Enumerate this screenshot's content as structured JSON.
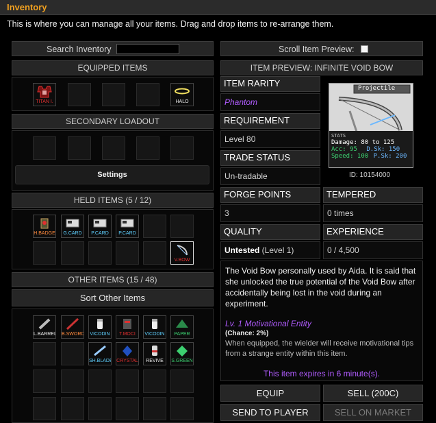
{
  "window": {
    "title": "Inventory"
  },
  "description": "This is where you can manage all your items. Drag and drop items to re-arrange them.",
  "search": {
    "label": "Search Inventory",
    "value": "",
    "placeholder": ""
  },
  "scroll_preview": {
    "label": "Scroll Item Preview:",
    "checked": false
  },
  "sections": {
    "equipped": "EQUIPPED ITEMS",
    "secondary": "SECONDARY LOADOUT",
    "settings_button": "Settings",
    "held": "HELD ITEMS (5 / 12)",
    "other": "OTHER ITEMS (15 / 48)",
    "sort_button": "Sort Other Items"
  },
  "equipped_items": [
    {
      "label": "TITAN I.",
      "icon": "titan-icon",
      "color": "#e03030"
    },
    {
      "label": "HALO",
      "icon": "halo-icon",
      "color": "#f0f0f0"
    }
  ],
  "held_items": [
    {
      "label": "H.BADGE",
      "icon": "badge-icon",
      "color": "#ff8a3d"
    },
    {
      "label": "G.CARD",
      "icon": "card-icon",
      "color": "#5fd0ff"
    },
    {
      "label": "P.CARD",
      "icon": "card-icon",
      "color": "#5fd0ff"
    },
    {
      "label": "P.CARD",
      "icon": "card-icon",
      "color": "#5fd0ff"
    },
    {
      "label": "V.BOW",
      "icon": "bow-icon",
      "color": "#e03030"
    }
  ],
  "other_items": [
    {
      "label": "L.BARREL",
      "icon": "barrel-icon",
      "color": "#f0f0f0"
    },
    {
      "label": "B.SWORD",
      "icon": "sword-icon",
      "color": "#ff8a3d"
    },
    {
      "label": "VICODIN",
      "icon": "pill-icon",
      "color": "#5fd0ff"
    },
    {
      "label": "T.MOCI",
      "icon": "potion-icon",
      "color": "#e03030"
    },
    {
      "label": "VICODIN",
      "icon": "pill-icon",
      "color": "#5fd0ff"
    },
    {
      "label": "PAPER",
      "icon": "hat-icon",
      "color": "#3cd070"
    },
    {
      "label": "SH.BLADE",
      "icon": "blade-icon",
      "color": "#5fd0ff"
    },
    {
      "label": "CRYSTAL",
      "icon": "crystal-icon",
      "color": "#e03030"
    },
    {
      "label": "REVIVE",
      "icon": "revive-icon",
      "color": "#f0f0f0"
    },
    {
      "label": "S.GREEN",
      "icon": "gem-icon",
      "color": "#3cd070"
    }
  ],
  "preview": {
    "header": "ITEM PREVIEW: INFINITE VOID BOW",
    "card_title": "Projectile",
    "stats_label": "STATS",
    "damage": "Damage: 80 to 125",
    "acc": "Acc: 95",
    "dsk": "D.Sk: 150",
    "speed": "Speed: 100",
    "psk": "P.Sk: 200",
    "id": "ID: 10154000"
  },
  "item_rarity": {
    "label": "ITEM RARITY",
    "value": "Phantom",
    "color": "#b15cff"
  },
  "requirement": {
    "label": "REQUIREMENT",
    "value": "Level 80"
  },
  "trade_status": {
    "label": "TRADE STATUS",
    "value": "Un-tradable"
  },
  "forge_points": {
    "label": "FORGE POINTS",
    "value": "3"
  },
  "tempered": {
    "label": "TEMPERED",
    "value": "0 times"
  },
  "quality": {
    "label": "QUALITY",
    "value_strong": "Untested",
    "value_rest": " (Level 1)"
  },
  "experience": {
    "label": "EXPERIENCE",
    "value": "0 / 4,500"
  },
  "item_description": "The Void Bow personally used by Aida. It is said that she unlocked the true potential of the Void Bow after accidentally being lost in the void during an experiment.",
  "entity": {
    "name": "Lv. 1 Motivational Entity",
    "chance": "(Chance: 2%)",
    "text": "When equipped, the wielder will receive motivational tips from a strange entity within this item."
  },
  "expiry": "This item expires in 6 minute(s).",
  "actions": {
    "equip": "EQUIP",
    "sell": "SELL (200C)",
    "send": "SEND TO PLAYER",
    "market": "SELL ON MARKET"
  }
}
